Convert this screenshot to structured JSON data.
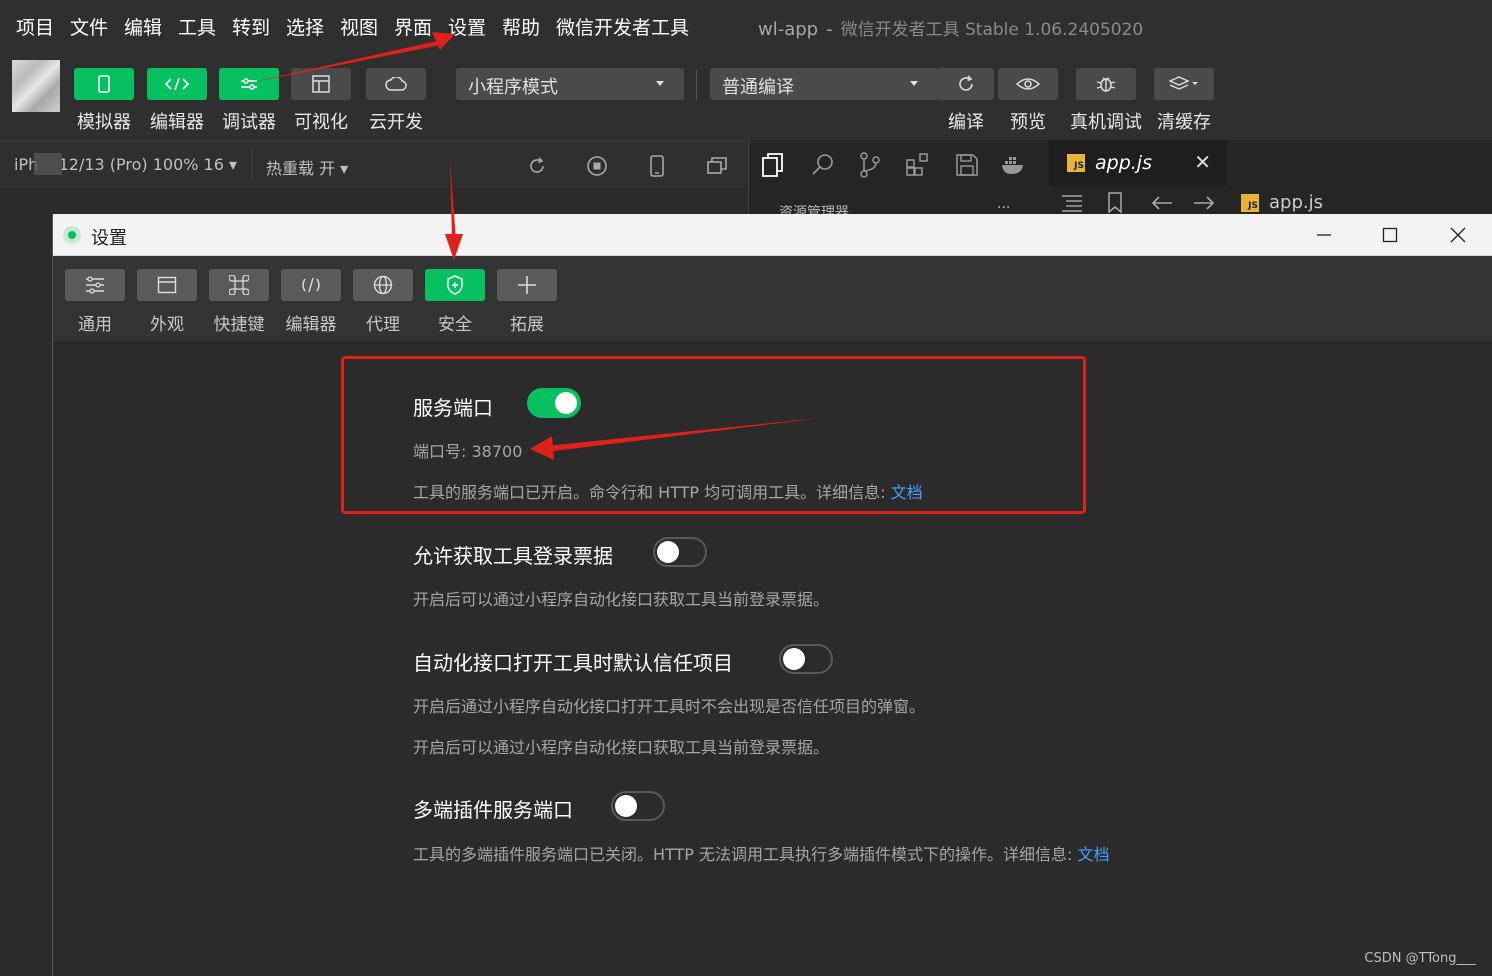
{
  "menubar": {
    "items": [
      "项目",
      "文件",
      "编辑",
      "工具",
      "转到",
      "选择",
      "视图",
      "界面",
      "设置",
      "帮助",
      "微信开发者工具"
    ],
    "app_name": "wl-app",
    "separator": "-",
    "product": "微信开发者工具 Stable 1.06.2405020"
  },
  "toolbar": {
    "buttons": [
      {
        "label": "模拟器",
        "icon": "phone-icon",
        "active": true
      },
      {
        "label": "编辑器",
        "icon": "code-icon",
        "active": true
      },
      {
        "label": "调试器",
        "icon": "debugger-icon",
        "active": true
      },
      {
        "label": "可视化",
        "icon": "layout-icon",
        "active": false
      },
      {
        "label": "云开发",
        "icon": "cloud-icon",
        "active": false
      }
    ],
    "mode_select": "小程序模式",
    "compile_select": "普通编译",
    "right_buttons": [
      {
        "label": "编译",
        "icon": "refresh-icon"
      },
      {
        "label": "预览",
        "icon": "eye-icon"
      },
      {
        "label": "真机调试",
        "icon": "bug-icon"
      },
      {
        "label": "清缓存",
        "icon": "layers-icon"
      }
    ]
  },
  "devicebar": {
    "device": "12/13 (Pro) 100% 16",
    "device_prefix": "iPh",
    "hot_reload": "热重载 开"
  },
  "editor": {
    "active_tab": "app.js",
    "explorer_label": "资源管理器",
    "more": "···",
    "breadcrumb_file": "app.js",
    "js_badge": "JS"
  },
  "dialog": {
    "title": "设置",
    "tabs": [
      {
        "label": "通用",
        "icon": "sliders-icon",
        "active": false
      },
      {
        "label": "外观",
        "icon": "window-icon",
        "active": false
      },
      {
        "label": "快捷键",
        "icon": "command-icon",
        "active": false
      },
      {
        "label": "编辑器",
        "icon": "code-icon",
        "active": false
      },
      {
        "label": "代理",
        "icon": "globe-icon",
        "active": false
      },
      {
        "label": "安全",
        "icon": "shield-icon",
        "active": true
      },
      {
        "label": "拓展",
        "icon": "plus-icon",
        "active": false
      }
    ],
    "settings": {
      "service_port": {
        "title": "服务端口",
        "enabled": true,
        "port_label": "端口号: 38700",
        "desc": "工具的服务端口已开启。命令行和 HTTP 均可调用工具。详细信息: ",
        "link": "文档"
      },
      "login_ticket": {
        "title": "允许获取工具登录票据",
        "enabled": false,
        "desc": "开启后可以通过小程序自动化接口获取工具当前登录票据。"
      },
      "trust_project": {
        "title": "自动化接口打开工具时默认信任项目",
        "enabled": false,
        "desc1": "开启后通过小程序自动化接口打开工具时不会出现是否信任项目的弹窗。",
        "desc2": "开启后可以通过小程序自动化接口获取工具当前登录票据。"
      },
      "multi_plugin": {
        "title": "多端插件服务端口",
        "enabled": false,
        "desc": "工具的多端插件服务端口已关闭。HTTP 无法调用工具执行多端插件模式下的操作。详细信息: ",
        "link": "文档"
      }
    }
  },
  "colors": {
    "accent": "#07c160",
    "annotation": "#e0201a",
    "link": "#4a9eff"
  },
  "watermark": "CSDN @TTong___"
}
